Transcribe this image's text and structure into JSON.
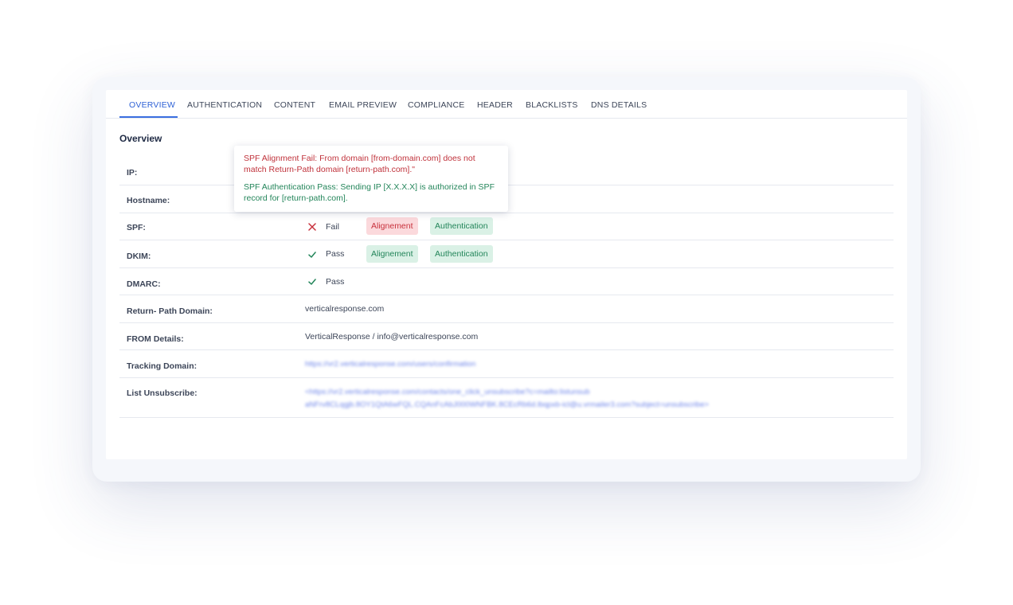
{
  "tabs": [
    {
      "label": "OVERVIEW",
      "active": true
    },
    {
      "label": "AUTHENTICATION",
      "active": false
    },
    {
      "label": "CONTENT",
      "active": false
    },
    {
      "label": "EMAIL PREVIEW",
      "active": false
    },
    {
      "label": "COMPLIANCE",
      "active": false
    },
    {
      "label": "HEADER",
      "active": false
    },
    {
      "label": "BLACKLISTS",
      "active": false
    },
    {
      "label": "DNS DETAILS",
      "active": false
    }
  ],
  "section_title": "Overview",
  "tooltip": {
    "fail_text": "SPF Alignment Fail: From domain [from-domain.com] does not match Return-Path domain [return-path.com].\"",
    "pass_text": "SPF Authentication Pass: Sending IP [X.X.X.X] is authorized in SPF record for [return-path.com]."
  },
  "rows": {
    "ip": {
      "label": "IP:"
    },
    "hostname": {
      "label": "Hostname:"
    },
    "spf": {
      "label": "SPF:",
      "status": "Fail",
      "status_icon": "cross-icon",
      "alignment": "Alignement",
      "authentication": "Authentication"
    },
    "dkim": {
      "label": "DKIM:",
      "status": "Pass",
      "status_icon": "check-icon",
      "alignment": "Alignement",
      "authentication": "Authentication"
    },
    "dmarc": {
      "label": "DMARC:",
      "status": "Pass",
      "status_icon": "check-icon"
    },
    "return_path": {
      "label": "Return- Path Domain:",
      "value": "verticalresponse.com"
    },
    "from_details": {
      "label": "FROM Details:",
      "value": "VerticalResponse / info@verticalresponse.com"
    },
    "tracking": {
      "label": "Tracking Domain:",
      "value": "https://vr2.verticalresponse.com/users/confirmation"
    },
    "list_unsubscribe": {
      "label": "List Unsubscribe:",
      "line1": "<https://vr2.verticalresponse.com/contacts/one_click_unsubscribe?c=mailto:listunsub",
      "line2": "aNFrv8CLqgjb.8OY1QtA6wFQL.CQAnFcAbJ000WNFBK.8CEcRb6d.lbqpxb-icl@u.vrmailer3.com?subject=unsubscribe>"
    }
  },
  "colors": {
    "accent": "#3b6fe0",
    "fail": "#c8323d",
    "pass": "#23855a",
    "fail_chip_bg": "#fbd9dc",
    "pass_chip_bg": "#daf1e6"
  }
}
